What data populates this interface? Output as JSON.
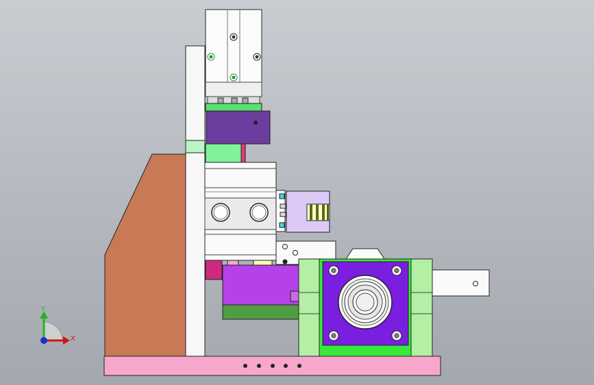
{
  "window": {
    "title": ""
  },
  "triad": {
    "x_label": "X",
    "y_label": "Y",
    "x_color": "#d21414",
    "y_color": "#22b422",
    "z_color": "#1a2fd6"
  },
  "colors": {
    "background_top": "#c9ccd1",
    "background_bottom": "#a3a8ae",
    "bracket_brown": "#c77a55",
    "base_pink": "#f7a7cb",
    "plate_purple": "#7a1ee0",
    "dark_purple": "#6b3d9e",
    "mint_green": "#7ff29a",
    "block_green": "#b3efa5",
    "lavender": "#dcc9f5",
    "dark_green": "#4f9e43",
    "bright_green": "#39e83c"
  }
}
